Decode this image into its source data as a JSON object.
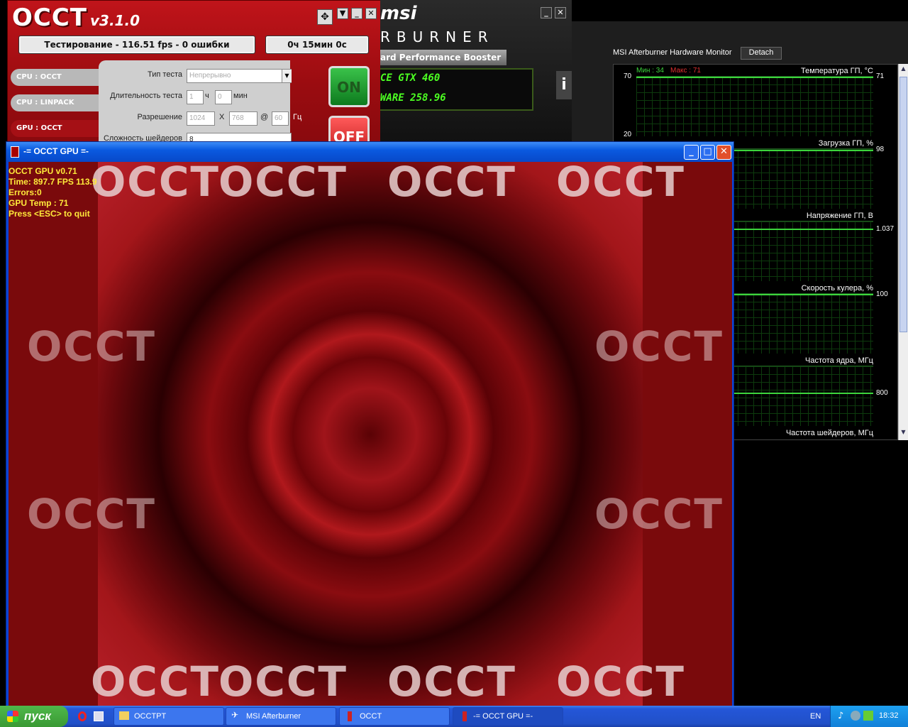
{
  "occt": {
    "logo": "OCCT",
    "version": "v3.1.0",
    "status": "Тестирование - 116.51 fps - 0 ошибки",
    "timer": "0ч 15мин 0с",
    "sidebar": [
      {
        "label": "CPU : OCCT"
      },
      {
        "label": "CPU : LINPACK"
      },
      {
        "label": "GPU : OCCT"
      }
    ],
    "form": {
      "test_type_label": "Тип теста",
      "test_type_value": "Непрерывно",
      "duration_label": "Длительность теста",
      "duration_hours": "1",
      "hours_unit": "ч",
      "duration_minutes": "0",
      "minutes_unit": "мин",
      "resolution_label": "Разрешение",
      "res_width": "1024",
      "res_x": "X",
      "res_height": "768",
      "res_at": "@",
      "refresh": "60",
      "refresh_unit": "Гц",
      "shader_label": "Сложность шейдеров",
      "shader_value": "8"
    },
    "on_label": "ON",
    "off_label": "OFF"
  },
  "msi": {
    "brand": "msi",
    "burner": "RBURNER",
    "booster": "ard Performance Booster",
    "gpu_name": "CE GTX 460",
    "driver": "WARE 258.96"
  },
  "monitor": {
    "title": "MSI Afterburner Hardware Monitor",
    "detach": "Detach",
    "min_label": "Мин : 34",
    "max_label": "Макс : 71",
    "graphs": [
      {
        "label": "Температура ГП, °C",
        "value": "71",
        "ymax": "70",
        "ymin": "20"
      },
      {
        "label": "Загрузка ГП, %",
        "value": "98"
      },
      {
        "label": "Напряжение ГП, В",
        "value": "1.037"
      },
      {
        "label": "Скорость кулера, %",
        "value": "100"
      },
      {
        "label": "Частота ядра, МГц",
        "value": "800"
      },
      {
        "label": "Частота шейдеров, МГц",
        "value": ""
      }
    ]
  },
  "gpu_window": {
    "title": "-= OCCT GPU =-",
    "watermark": "OCCT",
    "hud": {
      "line1": "OCCT GPU v0.71",
      "line2": "Time: 897.7  FPS 113.9",
      "line3": "Errors:0",
      "line4": "GPU Temp : 71",
      "line5": "Press <ESC> to quit"
    }
  },
  "taskbar": {
    "start": "пуск",
    "tasks": [
      {
        "label": "OCCTPT"
      },
      {
        "label": "MSI Afterburner"
      },
      {
        "label": "OCCT"
      },
      {
        "label": "-= OCCT GPU =-"
      }
    ],
    "lang": "EN",
    "clock": "18:32"
  },
  "colors": {
    "accent_red": "#a51015",
    "graph_green": "#3cd53c",
    "hud_yellow": "#ffea3a",
    "xp_blue": "#0a5ae0"
  }
}
